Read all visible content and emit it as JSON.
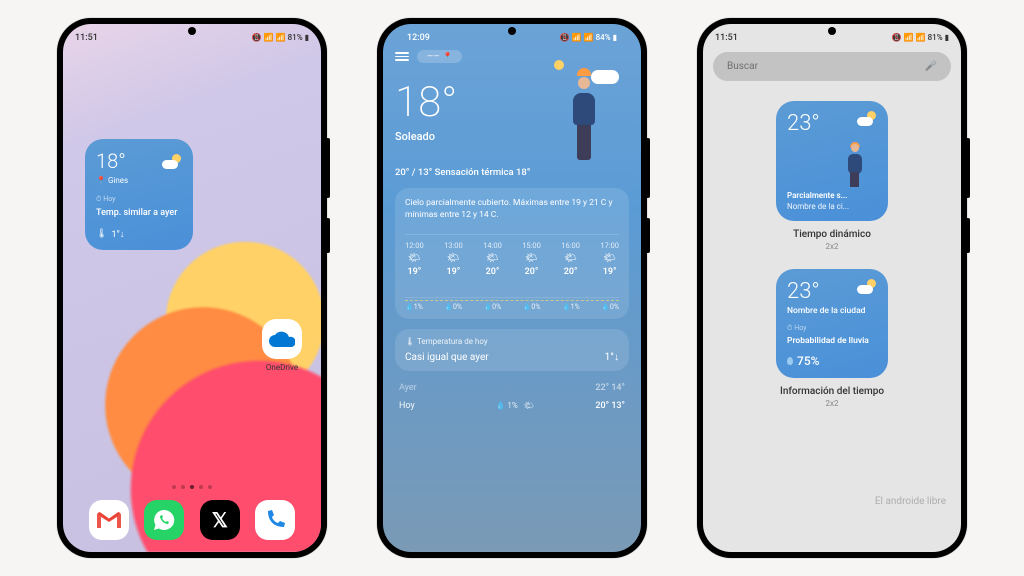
{
  "phone1": {
    "status": {
      "time": "11:51",
      "battery": "81%",
      "icons": "📷"
    },
    "widget": {
      "temp": "18°",
      "location": "Gines",
      "hoy_label": "⏱ Hoy",
      "summary": "Temp. similar a ayer",
      "delta": "1°↓"
    },
    "apps": {
      "onedrive": "OneDrive"
    },
    "dock": {
      "gmail": "M",
      "whatsapp": "wa",
      "x": "𝕏",
      "phone": "ph"
    }
  },
  "phone2": {
    "status": {
      "time": "12:09",
      "battery": "84%"
    },
    "location": "——",
    "temp": "18°",
    "condition": "Soleado",
    "feels_like": "20° / 13° Sensación térmica 18°",
    "summary": "Cielo parcialmente cubierto. Máximas entre 19 y 21 C y mínimas entre 12 y 14 C.",
    "hourly": [
      {
        "time": "12:00",
        "temp": "19°"
      },
      {
        "time": "13:00",
        "temp": "19°"
      },
      {
        "time": "14:00",
        "temp": "20°"
      },
      {
        "time": "15:00",
        "temp": "20°"
      },
      {
        "time": "16:00",
        "temp": "20°"
      },
      {
        "time": "17:00",
        "temp": "19°"
      }
    ],
    "precip": [
      "💧1%",
      "💧0%",
      "💧0%",
      "💧0%",
      "💧1%",
      "💧0%"
    ],
    "today_card": {
      "title": "🌡 Temperatura de hoy",
      "compare": "Casi igual que ayer",
      "delta": "1°↓"
    },
    "daily": [
      {
        "day": "Ayer",
        "precip": "",
        "icon": "",
        "range": "22° 14°"
      },
      {
        "day": "Hoy",
        "precip": "💧 1%",
        "icon": "🌤",
        "range": "20° 13°"
      }
    ]
  },
  "phone3": {
    "status": {
      "time": "11:51",
      "battery": "81%"
    },
    "search_placeholder": "Buscar",
    "widget1": {
      "temp": "23°",
      "condition": "Parcialmente s...",
      "city": "Nombre de la ci...",
      "title": "Tiempo dinámico",
      "size": "2x2"
    },
    "widget2": {
      "temp": "23°",
      "city": "Nombre de la ciudad",
      "hoy_label": "⏱ Hoy",
      "prob_label": "Probabilidad de lluvia",
      "precip": "75%",
      "title": "Información del tiempo",
      "size": "2x2"
    },
    "watermark": "El androide libre"
  }
}
